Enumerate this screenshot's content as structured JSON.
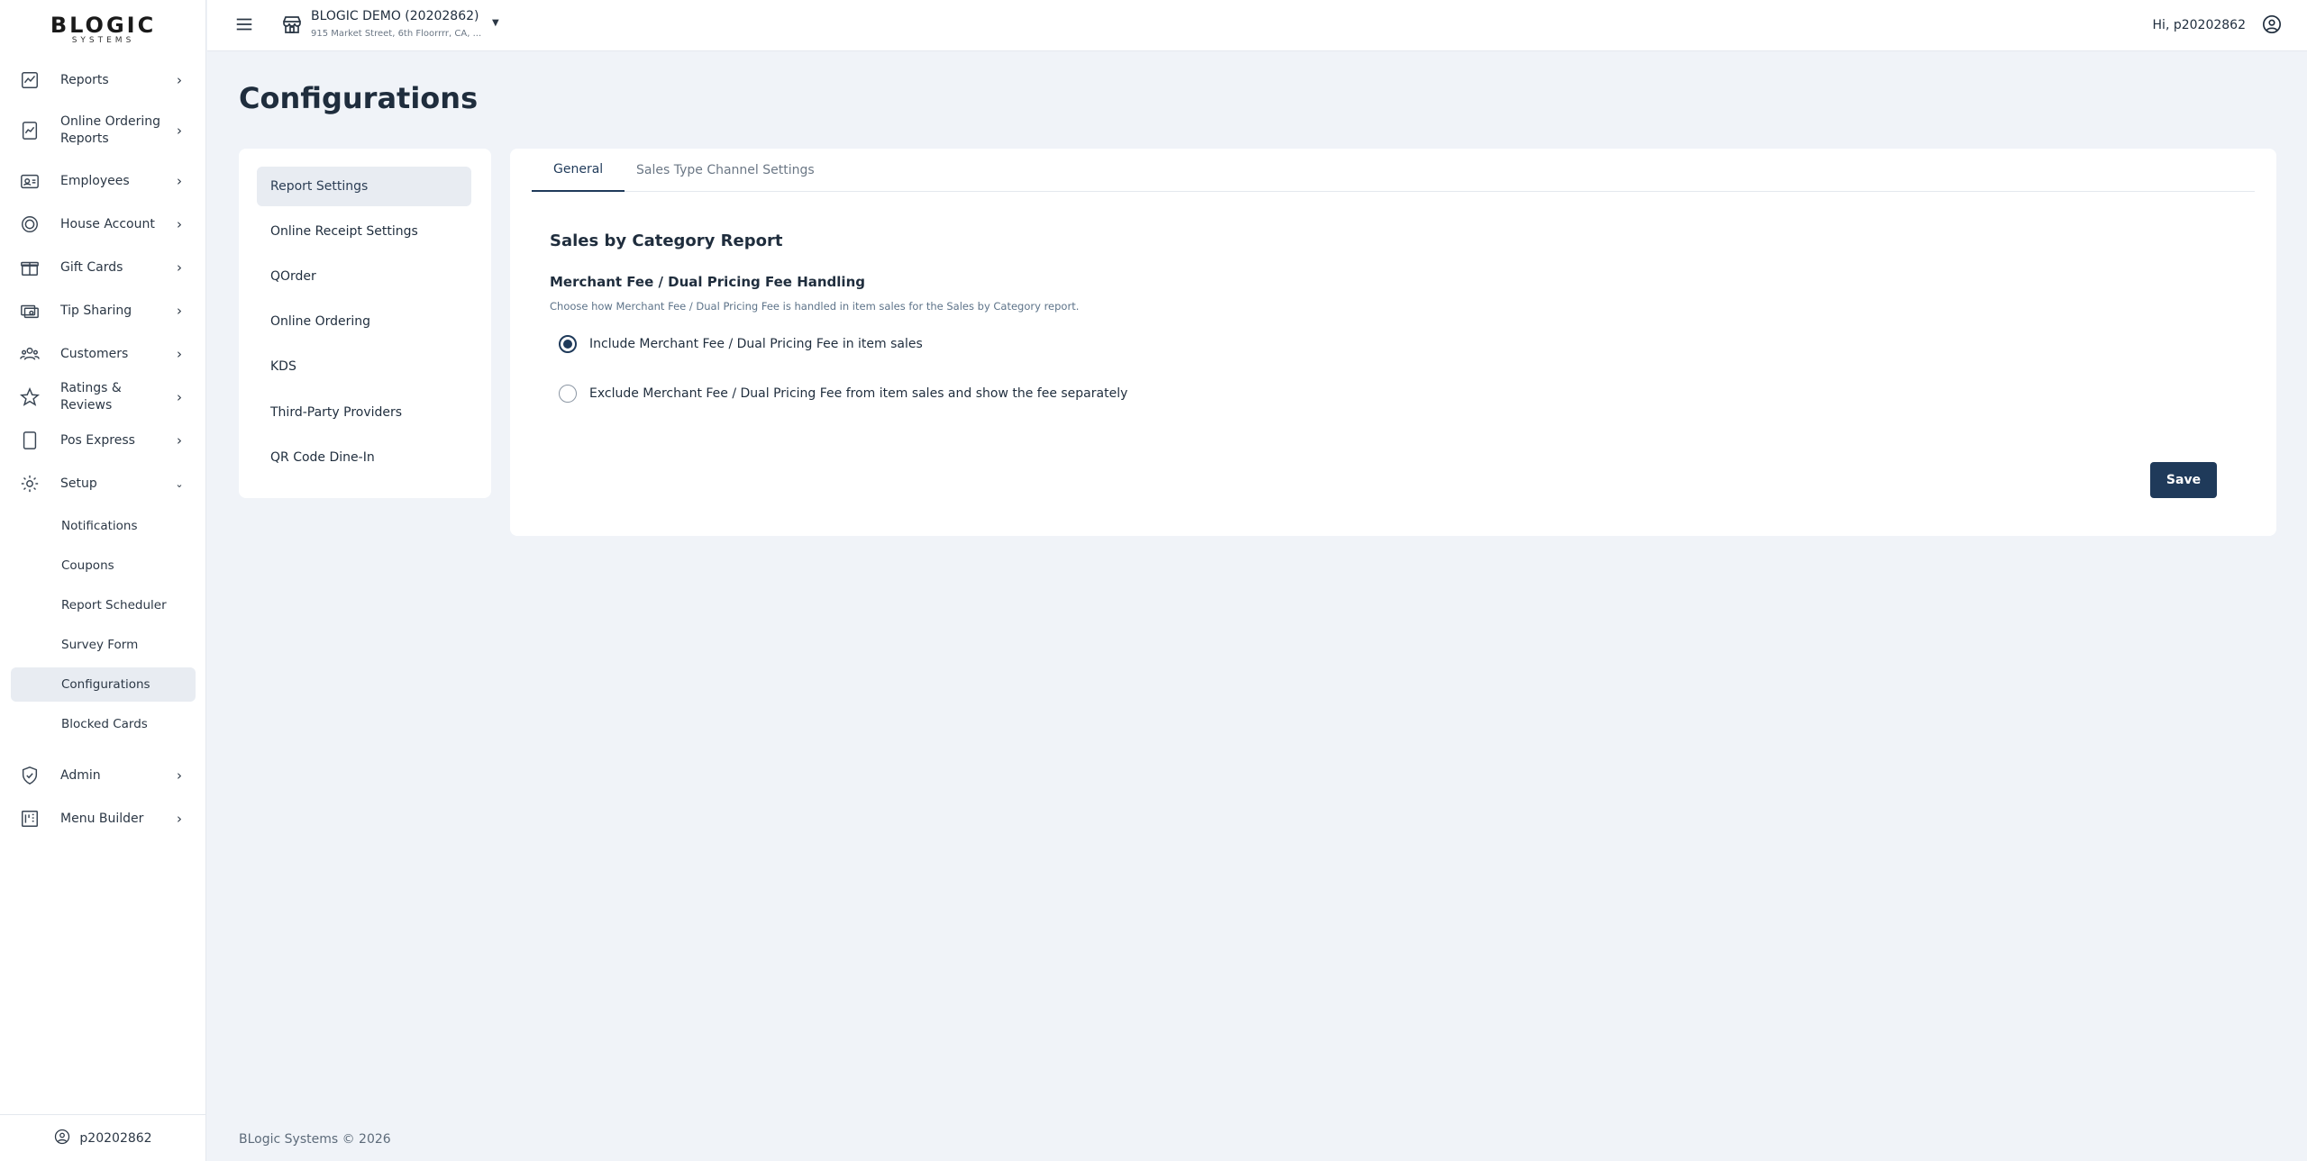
{
  "app": {
    "logo_text": "BLOGIC",
    "logo_sub": "SYSTEMS"
  },
  "sidebar": {
    "items": [
      {
        "label": "Reports",
        "icon": "chart-line-icon"
      },
      {
        "label": "Online Ordering Reports",
        "icon": "chart-doc-icon"
      },
      {
        "label": "Employees",
        "icon": "id-card-icon"
      },
      {
        "label": "House Account",
        "icon": "coin-icon"
      },
      {
        "label": "Gift Cards",
        "icon": "gift-icon"
      },
      {
        "label": "Tip Sharing",
        "icon": "cash-icon"
      },
      {
        "label": "Customers",
        "icon": "users-icon"
      },
      {
        "label": "Ratings & Reviews",
        "icon": "star-icon"
      },
      {
        "label": "Pos Express",
        "icon": "tablet-icon"
      },
      {
        "label": "Setup",
        "icon": "gear-icon"
      },
      {
        "label": "Admin",
        "icon": "shield-icon"
      },
      {
        "label": "Menu Builder",
        "icon": "menu-book-icon"
      }
    ],
    "setup_sub_items": [
      {
        "label": "Notifications"
      },
      {
        "label": "Coupons"
      },
      {
        "label": "Report Scheduler"
      },
      {
        "label": "Survey Form"
      },
      {
        "label": "Configurations"
      },
      {
        "label": "Blocked Cards"
      }
    ],
    "footer_user": "p20202862"
  },
  "topbar": {
    "store_name": "BLOGIC DEMO (20202862)",
    "store_address": "915 Market Street, 6th Floorrrr, CA, ...",
    "greeting": "Hi, p20202862"
  },
  "page": {
    "title": "Configurations",
    "footer": "BLogic Systems © 2026"
  },
  "settings_menu": [
    {
      "label": "Report Settings"
    },
    {
      "label": "Online Receipt Settings"
    },
    {
      "label": "QOrder"
    },
    {
      "label": "Online Ordering"
    },
    {
      "label": "KDS"
    },
    {
      "label": "Third-Party Providers"
    },
    {
      "label": "QR Code Dine-In"
    }
  ],
  "tabs": [
    {
      "label": "General"
    },
    {
      "label": "Sales Type Channel Settings"
    }
  ],
  "content": {
    "section_title": "Sales by Category Report",
    "sub_title": "Merchant Fee / Dual Pricing Fee Handling",
    "description": "Choose how Merchant Fee / Dual Pricing Fee is handled in item sales for the Sales by Category report.",
    "options": [
      {
        "label": "Include Merchant Fee / Dual Pricing Fee in item sales",
        "selected": true
      },
      {
        "label": "Exclude Merchant Fee / Dual Pricing Fee from item sales and show the fee separately",
        "selected": false
      }
    ],
    "save_label": "Save"
  },
  "colors": {
    "primary": "#1f3a5a",
    "background": "#f0f3f8",
    "active_bg": "#e8ecf2"
  }
}
